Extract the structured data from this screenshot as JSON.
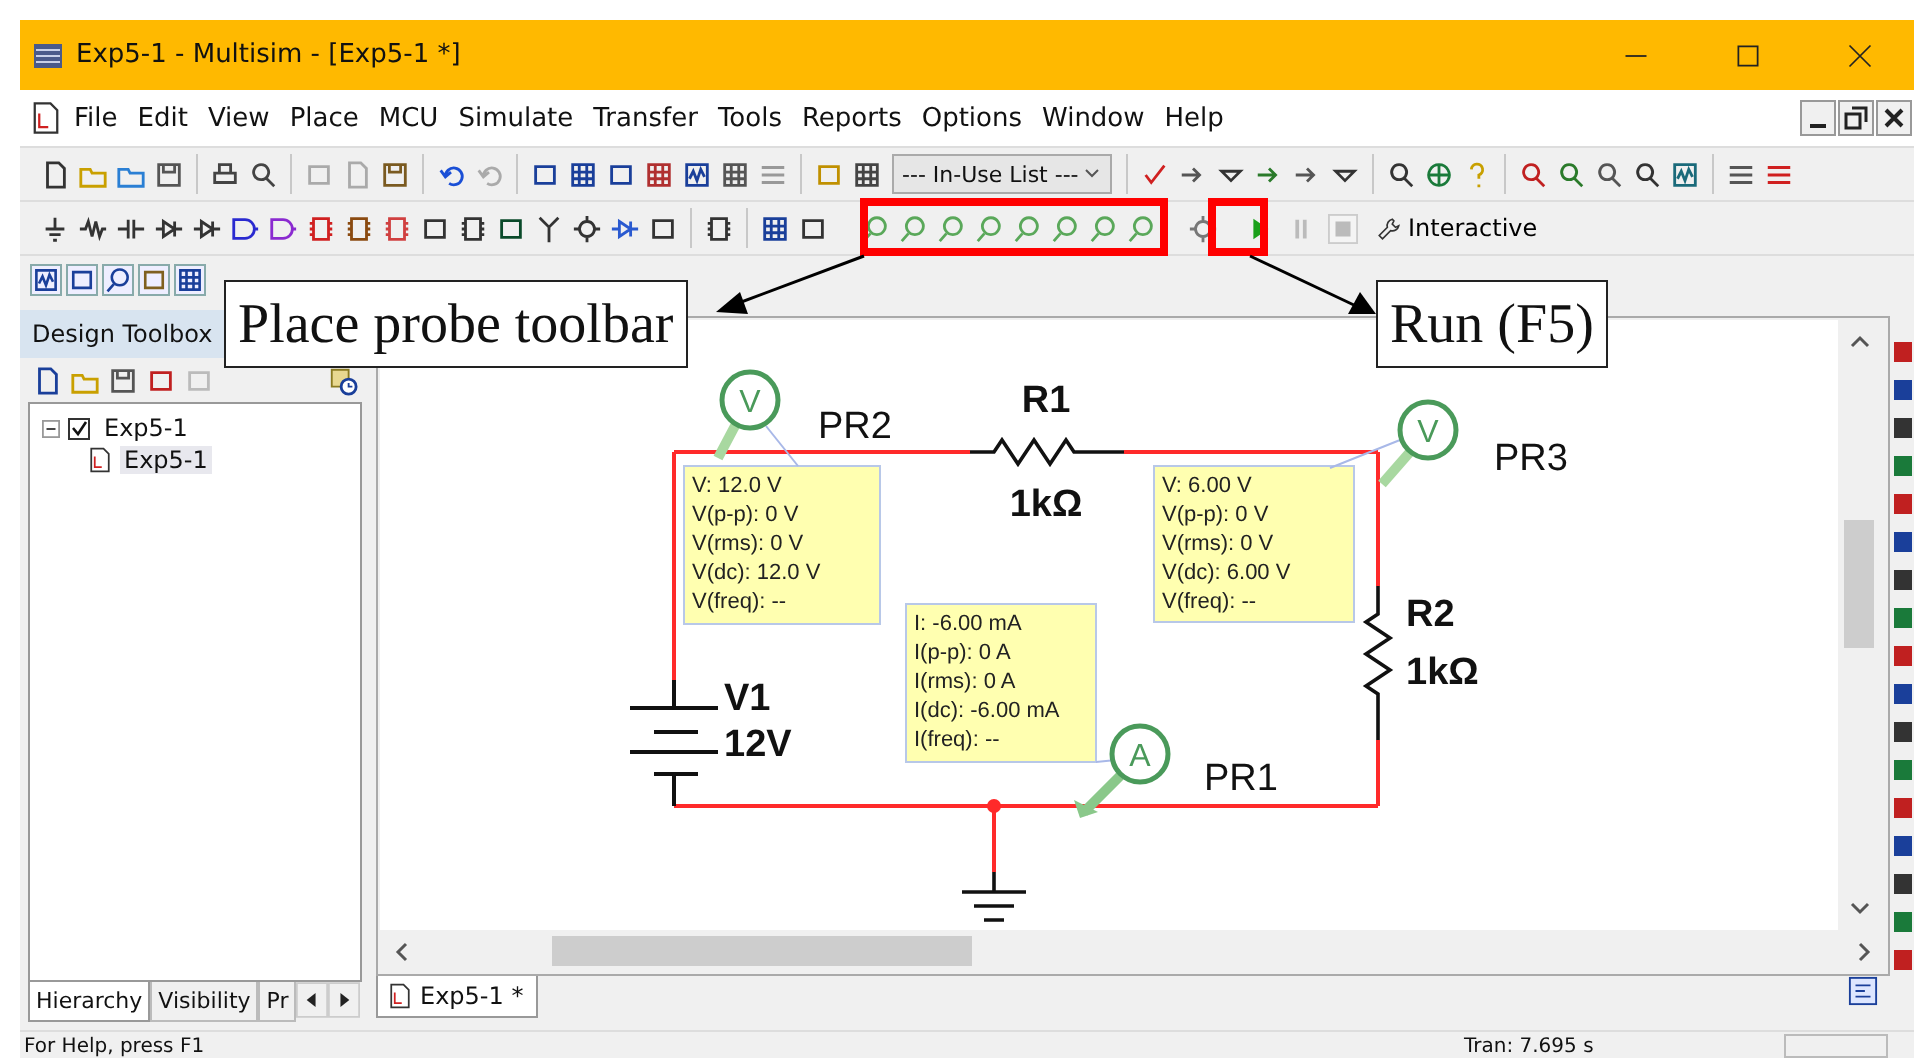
{
  "window": {
    "title": "Exp5-1 - Multisim - [Exp5-1 *]"
  },
  "menu": [
    "File",
    "Edit",
    "View",
    "Place",
    "MCU",
    "Simulate",
    "Transfer",
    "Tools",
    "Reports",
    "Options",
    "Window",
    "Help"
  ],
  "toolbar": {
    "dropdown": {
      "value": "--- In-Use List ---"
    },
    "interactive": {
      "label": "Interactive"
    },
    "sim_controls": [
      {
        "kind": "run",
        "disabled": false
      },
      {
        "kind": "pause",
        "disabled": true
      },
      {
        "kind": "stop",
        "disabled": true
      }
    ]
  },
  "design_toolbox": {
    "title": "Design Toolbox",
    "tree": [
      {
        "label": "Exp5-1",
        "checked": true,
        "expanded": true,
        "selected": false,
        "children": [
          {
            "label": "Exp5-1",
            "selected": true
          }
        ]
      }
    ],
    "tabs": [
      {
        "label": "Hierarchy",
        "selected": true
      },
      {
        "label": "Visibility",
        "selected": false
      },
      {
        "label": "Pr",
        "selected": false
      }
    ]
  },
  "schematic": {
    "components": [
      {
        "kind": "resistor",
        "ref": "R1",
        "value": "1kΩ"
      },
      {
        "kind": "resistor",
        "ref": "R2",
        "value": "1kΩ"
      },
      {
        "kind": "battery",
        "ref": "V1",
        "value": "12V"
      }
    ],
    "probes": [
      {
        "name": "PR2",
        "kind": "voltage",
        "letter": "V",
        "readings": [
          "V: 12.0 V",
          "V(p-p): 0 V",
          "V(rms): 0 V",
          "V(dc): 12.0 V",
          "V(freq): --"
        ]
      },
      {
        "name": "PR3",
        "kind": "voltage",
        "letter": "V",
        "readings": [
          "V: 6.00 V",
          "V(p-p): 0 V",
          "V(rms): 0 V",
          "V(dc): 6.00 V",
          "V(freq): --"
        ]
      },
      {
        "name": "PR1",
        "kind": "current",
        "letter": "A",
        "readings": [
          "I: -6.00 mA",
          "I(p-p): 0 A",
          "I(rms): 0 A",
          "I(dc): -6.00 mA",
          "I(freq): --"
        ]
      }
    ]
  },
  "document_tabs": [
    {
      "label": "Exp5-1 *",
      "selected": true
    }
  ],
  "status_bar": [
    "For Help, press F1",
    "Tran: 7.695 s"
  ],
  "callouts": [
    {
      "text": "Place probe toolbar"
    },
    {
      "text": "Run (F5)"
    }
  ]
}
